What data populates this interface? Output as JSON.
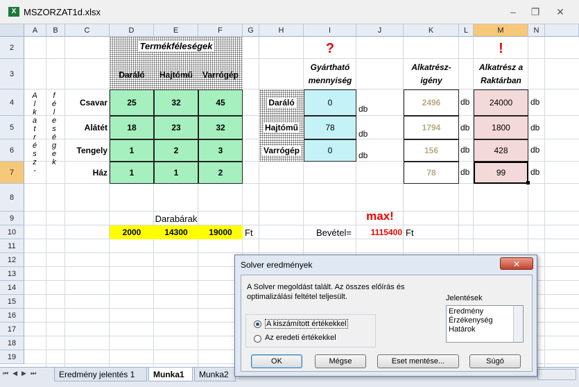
{
  "window": {
    "title": "MSZORZAT1d.xlsx",
    "minimize": "–",
    "restore": "❐",
    "close": "✕"
  },
  "columns": [
    "A",
    "B",
    "C",
    "D",
    "E",
    "F",
    "G",
    "H",
    "I",
    "J",
    "K",
    "L",
    "M",
    "N"
  ],
  "rows": [
    "2",
    "3",
    "4",
    "5",
    "6",
    "7",
    "8",
    "9",
    "10",
    "11",
    "12",
    "13",
    "14",
    "15",
    "16",
    "17",
    "18",
    "19"
  ],
  "sheet": {
    "product_types_title": "Termékféleségek",
    "products": [
      "Daráló",
      "Hajtómű",
      "Varrógép"
    ],
    "parts": [
      "Csavar",
      "Alátét",
      "Tengely",
      "Ház"
    ],
    "matrix": [
      [
        "25",
        "32",
        "45"
      ],
      [
        "18",
        "23",
        "32"
      ],
      [
        "1",
        "2",
        "3"
      ],
      [
        "1",
        "1",
        "2"
      ]
    ],
    "vertical_label_a": [
      "A",
      "l",
      "k",
      "a",
      "t",
      "r",
      "é",
      "s",
      "z",
      "-"
    ],
    "vertical_label_b": [
      "f",
      "é",
      "l",
      "e",
      "s",
      "é",
      "g",
      "e",
      "k"
    ],
    "qmark": "?",
    "producible_qty": "Gyártható mennyiség",
    "prod_values": [
      "0",
      "78",
      "0"
    ],
    "db": "db",
    "part_demand_label": "Alkatrész-igény",
    "part_demand": [
      "2496",
      "1794",
      "156",
      "78"
    ],
    "exclaim": "!",
    "in_stock_label": "Alkatrész a Raktárban",
    "in_stock": [
      "24000",
      "1800",
      "428",
      "99"
    ],
    "unit_prices_label": "Darabárak",
    "unit_prices": [
      "2000",
      "14300",
      "19000"
    ],
    "ft": "Ft",
    "max_label": "max!",
    "revenue_label": "Bevétel=",
    "revenue_value": "1115400"
  },
  "tabs": {
    "nav": [
      "⏮",
      "◀",
      "▶",
      "⏭"
    ],
    "items": [
      "Eredmény jelentés 1",
      "Munka1",
      "Munka2"
    ]
  },
  "dialog": {
    "title": "Solver eredmények",
    "message_line1": "A Solver megoldást talált. Az összes előírás és",
    "message_line2": "optimalizálási feltétel teljesült.",
    "reports_label": "Jelentések",
    "reports": [
      "Eredmény",
      "Érzékenység",
      "Határok"
    ],
    "radio1": "A kiszámított értékekkel",
    "radio2": "Az eredeti értékekkel",
    "ok": "OK",
    "cancel": "Mégse",
    "save": "Eset mentése...",
    "help": "Súgó"
  }
}
